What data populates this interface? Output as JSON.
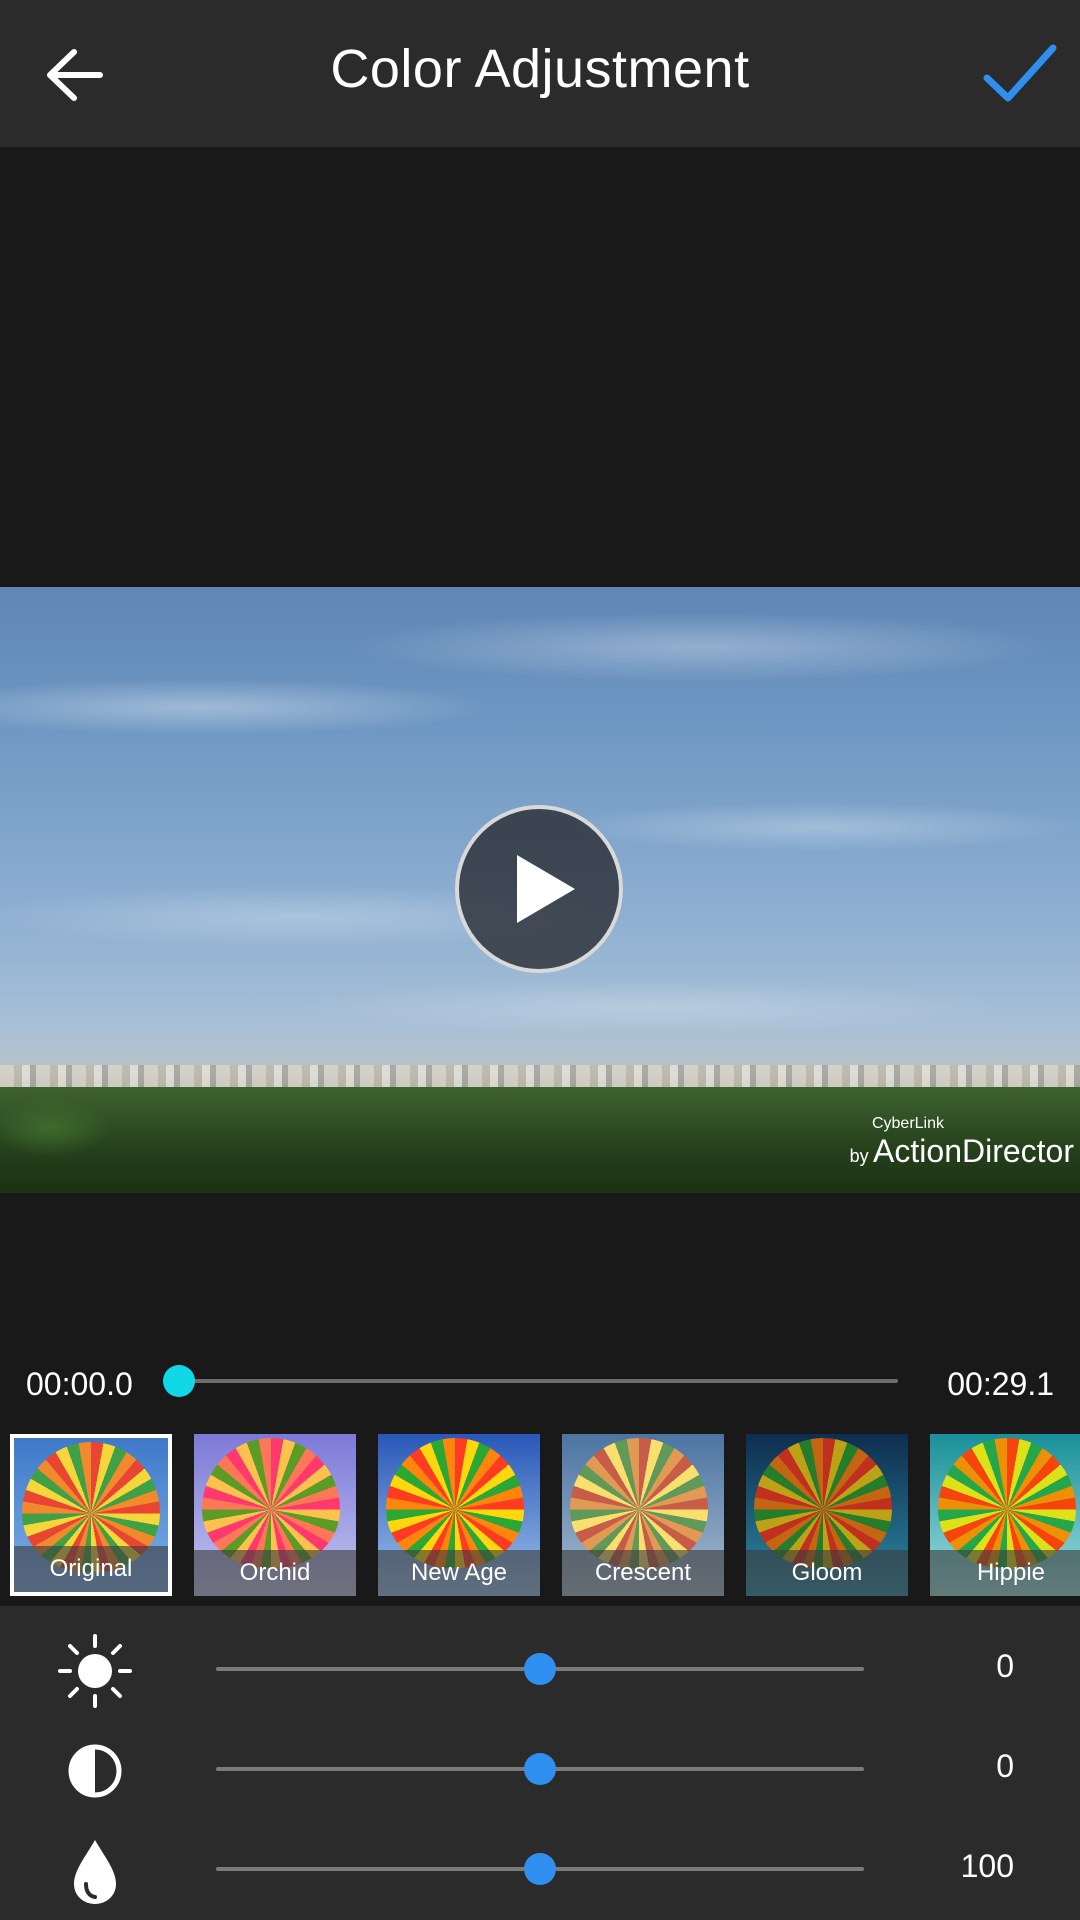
{
  "header": {
    "title": "Color Adjustment",
    "back_icon": "arrow-left-icon",
    "confirm_icon": "checkmark-icon",
    "accent_color": "#2f8ff0"
  },
  "preview": {
    "play_icon": "play-icon",
    "watermark_brand": "CyberLink",
    "watermark_by": "by",
    "watermark_product": "ActionDirector"
  },
  "timeline": {
    "start_time": "00:00.0",
    "end_time": "00:29.1",
    "playhead_color": "#10d8e6",
    "playhead_position": 0.0
  },
  "filters": {
    "selected": "Original",
    "items": [
      {
        "label": "Original"
      },
      {
        "label": "Orchid"
      },
      {
        "label": "New Age"
      },
      {
        "label": "Crescent"
      },
      {
        "label": "Gloom"
      },
      {
        "label": "Hippie"
      }
    ]
  },
  "adjustments": {
    "brightness": {
      "icon": "brightness-sun-icon",
      "value": "0",
      "level": 0.5
    },
    "contrast": {
      "icon": "contrast-half-circle-icon",
      "value": "0",
      "level": 0.5
    },
    "saturation": {
      "icon": "saturation-drop-icon",
      "value": "100",
      "level": 0.5
    }
  }
}
